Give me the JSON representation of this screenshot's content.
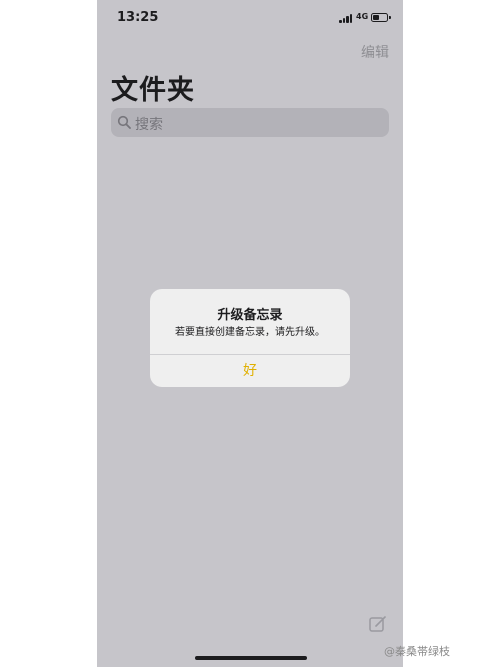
{
  "status_bar": {
    "time": "13:25",
    "network": "4G",
    "signal_icon": "cellular-signal-icon",
    "battery_icon": "battery-icon"
  },
  "nav": {
    "edit_label": "编辑"
  },
  "page": {
    "title": "文件夹"
  },
  "search": {
    "placeholder": "搜索",
    "icon": "magnifying-glass-icon"
  },
  "alert": {
    "title": "升级备忘录",
    "message": "若要直接创建备忘录，请先升级。",
    "ok_label": "好",
    "accent_color": "#e0b000"
  },
  "toolbar": {
    "compose_icon": "compose-icon"
  },
  "watermark": {
    "text": "@秦桑帯绿枝"
  },
  "colors": {
    "background": "#c6c5ca",
    "dialog_background": "#efefef",
    "secondary_text": "#8e8e93"
  }
}
